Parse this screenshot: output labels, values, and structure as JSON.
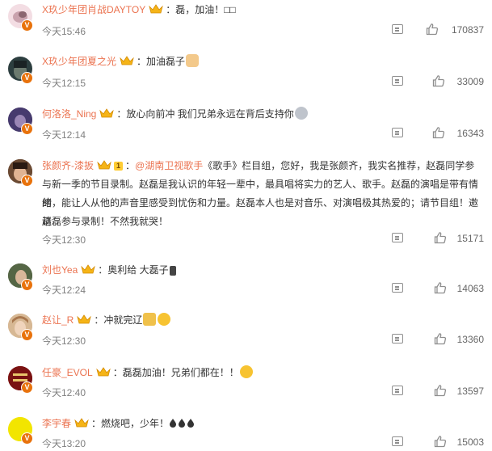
{
  "comments": [
    {
      "user": "X玖少年团肖战DAYTOY",
      "text": "：磊，加油！□□",
      "time": "今天15:46",
      "likes": "170837",
      "avatar_color": "#f3dde3"
    },
    {
      "user": "X玖少年团夏之光",
      "text": "：加油磊子",
      "time": "今天12:15",
      "likes": "33009",
      "avatar_color": "#2c3e3f"
    },
    {
      "user": "何洛洛_Ning",
      "text": "：放心向前冲 我们兄弟永远在背后支持你",
      "time": "今天12:14",
      "likes": "16343",
      "avatar_color": "#3d2f5c"
    },
    {
      "user": "张颜齐-漆扳",
      "level": "1",
      "text_parts": {
        "colon": "：",
        "mention": "@湖南卫视歌手",
        "rest_line1": "《歌手》栏目组，您好，我是张颜齐，我实名推荐，赵磊同学参",
        "line2": "与新一季的节目录制。赵磊是我认识的年轻一辈中，最具唱将实力的艺人、歌手。赵磊的演唱是带有情绪",
        "line3": "的，能让人从他的声音里感受到忧伤和力量。赵磊本人也是对音乐、对演唱极其热爱的；请节目组！邀请",
        "line4": "赵磊参与录制！不然我就哭！"
      },
      "time": "今天12:30",
      "likes": "15171",
      "avatar_color": "#5a3a2a"
    },
    {
      "user": "刘也Yea",
      "text": "：奥利给 大磊子",
      "time": "今天12:24",
      "likes": "14063",
      "avatar_color": "#4a5a3a"
    },
    {
      "user": "赵让_R",
      "text": "：冲就完辽",
      "time": "今天12:30",
      "likes": "13360",
      "avatar_color": "#c7a37e"
    },
    {
      "user": "任豪_EVOL",
      "text": "：磊磊加油！兄弟们都在！！",
      "time": "今天12:40",
      "likes": "13597",
      "avatar_color": "#8b1a1a"
    },
    {
      "user": "李宇春",
      "text": "：燃烧吧，少年！",
      "time": "今天13:20",
      "likes": "15003",
      "avatar_color": "#f2e500"
    }
  ],
  "colors": {
    "username": "#eb7350",
    "time": "#808080",
    "icon": "#8e8e8e",
    "badge": "#e8720c"
  },
  "icons": {
    "reply": "comment-icon",
    "like": "thumbs-up-icon",
    "verified": "verified-v-icon",
    "member": "crown-icon"
  }
}
